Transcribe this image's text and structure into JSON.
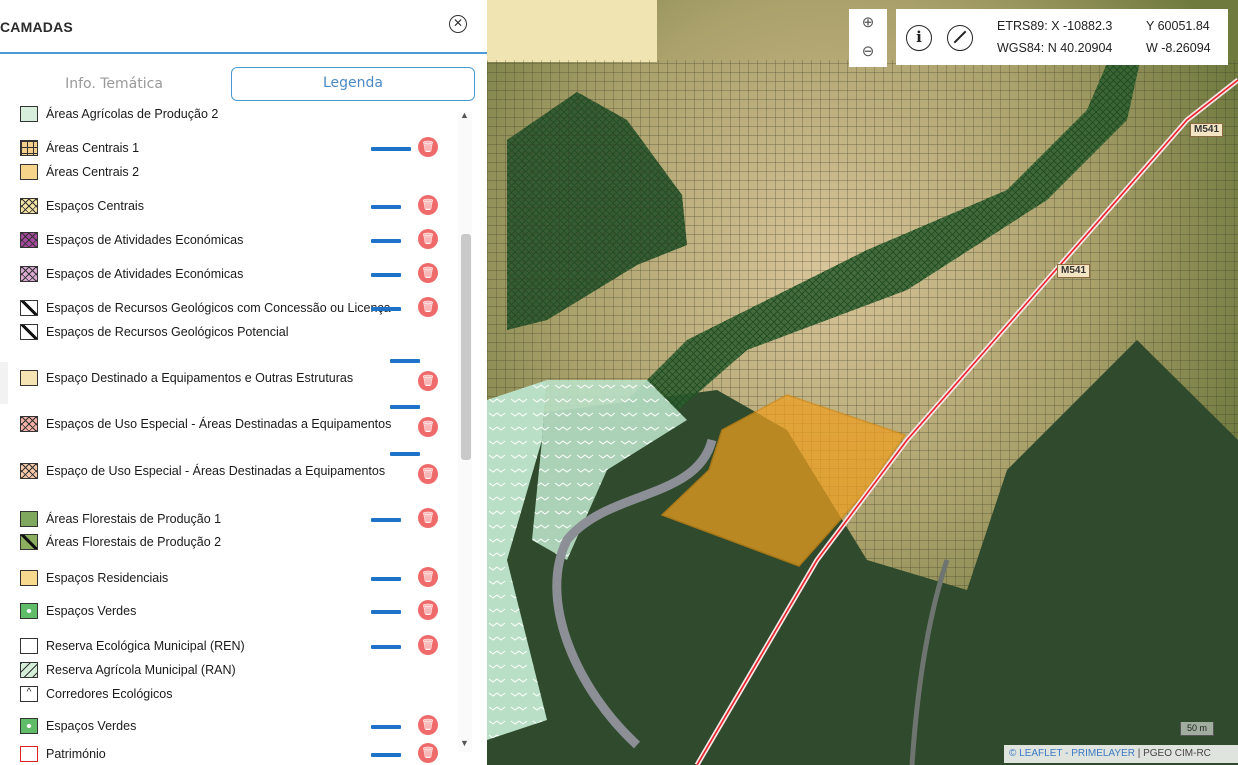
{
  "panel": {
    "title": "CAMADAS",
    "close_icon": "close-circle-icon",
    "tabs": [
      {
        "label": "Info. Temática",
        "active": false
      },
      {
        "label": "Legenda",
        "active": true
      }
    ]
  },
  "legend": {
    "items": [
      {
        "label": "Áreas Agrícolas de Produção 2",
        "swatch": "#d7eedd",
        "pattern": "plain"
      },
      {
        "label": "Áreas Centrais 1",
        "swatch": "#f4cf8c",
        "pattern": "grid"
      },
      {
        "label": "Áreas Centrais 2",
        "swatch": "#f6d48a",
        "pattern": "plain"
      },
      {
        "label": "Espaços Centrais",
        "swatch": "#f3e2a2",
        "pattern": "cross"
      },
      {
        "label": "Espaços de Atividades Económicas",
        "swatch": "#a34a9c",
        "pattern": "dense"
      },
      {
        "label": "Espaços de Atividades Económicas",
        "swatch": "#d9a8d3",
        "pattern": "cross"
      },
      {
        "label": "Espaços de Recursos Geológicos com Concessão ou Licença",
        "swatch": "#ffffff",
        "pattern": "slash"
      },
      {
        "label": "Espaços de Recursos Geológicos Potencial",
        "swatch": "#ffffff",
        "pattern": "dash"
      },
      {
        "label": "Espaço Destinado a Equipamentos e Outras Estruturas",
        "swatch": "#f4e4b4",
        "pattern": "plain"
      },
      {
        "label": "Espaços de Uso Especial - Áreas Destinadas a Equipamentos",
        "swatch": "#f2b0a6",
        "pattern": "dense"
      },
      {
        "label": "Espaço de Uso Especial - Áreas Destinadas a Equipamentos",
        "swatch": "#f6c9a8",
        "pattern": "cross"
      },
      {
        "label": "Áreas Florestais de Produção 1",
        "swatch": "#7fa75e",
        "pattern": "plain"
      },
      {
        "label": "Áreas Florestais de Produção 2",
        "swatch": "#8cae5f",
        "pattern": "slash"
      },
      {
        "label": "Espaços Residenciais",
        "swatch": "#f7da8e",
        "pattern": "plain"
      },
      {
        "label": "Espaços Verdes",
        "swatch": "#5fbd6a",
        "pattern": "dot"
      },
      {
        "label": "Reserva Ecológica Municipal (REN)",
        "swatch": "#ffffff",
        "pattern": "plain"
      },
      {
        "label": "Reserva Agrícola Municipal (RAN)",
        "swatch": "#d4eed8",
        "pattern": "wave"
      },
      {
        "label": "Corredores Ecológicos",
        "swatch": "#ffffff",
        "pattern": "caret"
      },
      {
        "label": "Espaços Verdes",
        "swatch": "#5fbd6a",
        "pattern": "dot"
      },
      {
        "label": "Património",
        "swatch": "#ffffff",
        "pattern": "red"
      }
    ],
    "delete_icon": "trash-icon",
    "scroll_up_icon": "scroll-up-arrow-icon",
    "scroll_down_icon": "scroll-down-arrow-icon"
  },
  "map": {
    "zoom_in_icon": "zoom-in-icon",
    "zoom_out_icon": "zoom-out-icon",
    "info_icon": "info-icon",
    "measure_icon": "measure-icon",
    "etrs_label": "ETRS89:",
    "etrs_x": "X -10882.3",
    "etrs_y": "Y 60051.84",
    "wgs_label": "WGS84:",
    "wgs_n": "N 40.20904",
    "wgs_w": "W -8.26094",
    "scale": "50 m",
    "road_labels": [
      "M541",
      "M541"
    ],
    "attribution_leaflet": "© LEAFLET - PRIMELAYER",
    "attribution_sep": "|",
    "attribution_source": "PGEO CIM-RC",
    "colors": {
      "forest": "#2f4a2c",
      "hatch": "#3d3d2a",
      "green_hatch": "#2f6b34",
      "parcel": "#f0a020",
      "road": "#e8202a",
      "ran": "#b9e0c6"
    }
  }
}
